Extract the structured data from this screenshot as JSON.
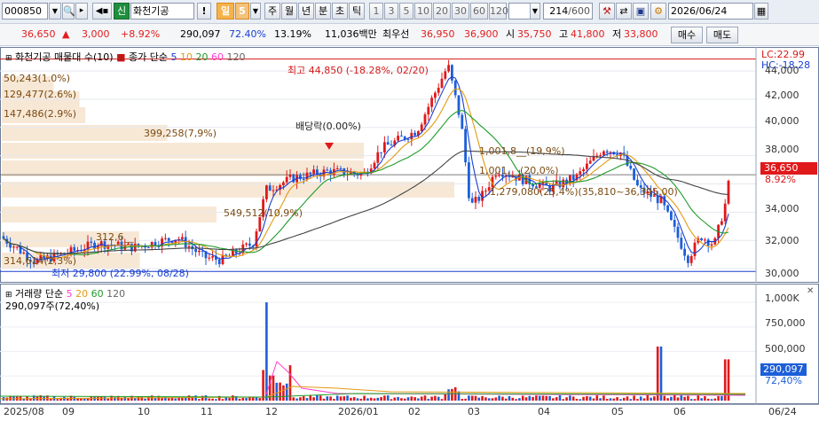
{
  "toolbar": {
    "stock_code": "000850",
    "stock_badge": "신",
    "stock_name": "화천기공",
    "excl": "!",
    "period_day": "일",
    "period_num": "5",
    "periods": [
      "주",
      "월",
      "년",
      "분",
      "초",
      "틱"
    ],
    "intervals": [
      "1",
      "3",
      "5",
      "10",
      "20",
      "30",
      "60",
      "120"
    ],
    "count": "214",
    "count_total": "/600",
    "date": "2026/06/24"
  },
  "quote": {
    "price": "36,650",
    "change": "3,000",
    "change_pct": "+8.92%",
    "volume": "290,097",
    "vol_ratio": "72.40%",
    "turnover_rate": "13.19%",
    "amount": "11,036백만",
    "best_ask_label": "최우선",
    "best_ask": "36,950",
    "best_bid": "36,900",
    "open_label": "시",
    "open": "35,750",
    "high_label": "고",
    "high": "41,800",
    "low_label": "저",
    "low": "33,800",
    "buy_label": "매수",
    "sell_label": "매도"
  },
  "price_pane": {
    "legend_name": "화천기공 매물대 수(10)",
    "legend_ma": "종가 단순",
    "ma_periods": [
      "5",
      "10",
      "20",
      "60",
      "120"
    ],
    "ma_colors": [
      "#1a3fd0",
      "#e39a12",
      "#1f9b2a",
      "#ff3fd0",
      "#666666"
    ],
    "lc_label": "LC:22.99",
    "hc_label": "HC:-18.28",
    "current_price_tag": "36,650",
    "current_pct_tag": "8.92%",
    "high_annotation": "최고 44,850 (-18.28%, 02/20)",
    "low_annotation": "최저 29,800 (22.99%, 08/28)",
    "dividend_annotation": "배당락(0.00%)",
    "y_ticks": [
      "44,000",
      "42,000",
      "40,000",
      "38,000",
      "36,000",
      "34,000",
      "32,000",
      "30,000"
    ],
    "volume_profile": [
      {
        "label": "50,243(1.0%)",
        "value": 50243
      },
      {
        "label": "129,477(2.6%)",
        "value": 129477
      },
      {
        "label": "147,486(2.9%)",
        "value": 147486
      },
      {
        "label": "399,258(7,9%)",
        "value": 399258
      },
      {
        "label": "1,001,8__(19,9%)",
        "value": 1001800
      },
      {
        "label": "1,001,__(20,0%)",
        "value": 1001000
      },
      {
        "label": "1,279,080(25,4%)(35,810~36,395,00)",
        "value": 1279080
      },
      {
        "label": "549,512(10,9%)",
        "value": 549512
      },
      {
        "label": "312,6__",
        "value": 312600
      },
      {
        "label": "314,614(2,3%)",
        "value": 314614
      }
    ]
  },
  "volume_pane": {
    "legend_name": "거래량 단순",
    "ma_periods": [
      "5",
      "20",
      "60",
      "120"
    ],
    "ma_colors": [
      "#ff3fd0",
      "#e39a12",
      "#1f9b2a",
      "#666666"
    ],
    "info": "290,097주(72,40%)",
    "y_ticks": [
      "1,000K",
      "750,000",
      "500,000",
      "250,000"
    ],
    "current_vol_tag": "290,097",
    "current_pct_tag": "72,40%"
  },
  "x_axis": {
    "labels": [
      "2025/08",
      "09",
      "10",
      "11",
      "12",
      "2026/01",
      "02",
      "03",
      "04",
      "05",
      "06"
    ],
    "right_date": "06/24"
  },
  "chart_data": {
    "type": "candlestick",
    "ylim": [
      29500,
      45200
    ],
    "high": 44850,
    "low": 29800,
    "last_close": 36650
  }
}
